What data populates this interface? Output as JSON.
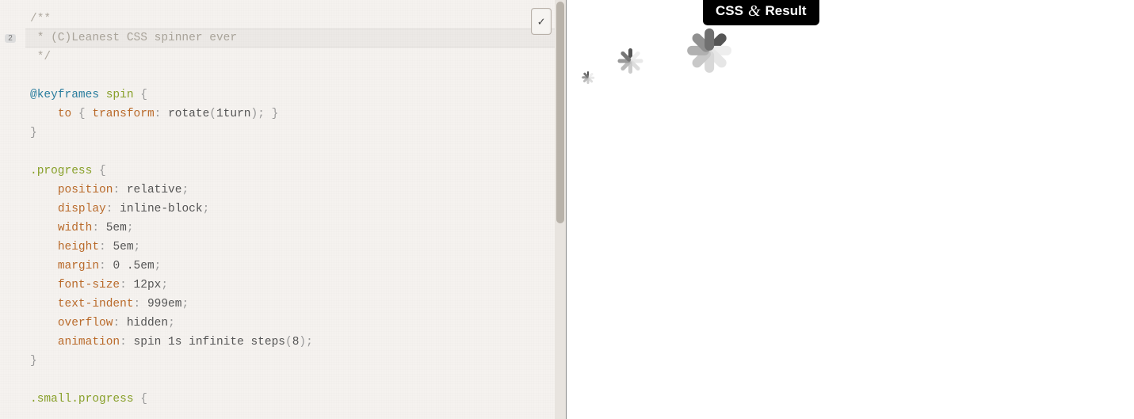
{
  "tab": {
    "left": "CSS",
    "amp": "&",
    "right": "Result"
  },
  "toggle_label": "✓",
  "lint": {
    "count": "2"
  },
  "code": {
    "l1": "/**",
    "l2a": " * ",
    "l2b": "(C)Leanest CSS spinner ever",
    "l3": " */",
    "l5a": "@keyframes",
    "l5b": "spin",
    "l5c": "{",
    "l6a": "to",
    "l6b": "{",
    "l6c": "transform",
    "l6d": ":",
    "l6e": "rotate",
    "l6f": "(",
    "l6g": "1turn",
    "l6h": ")",
    "l6i": ";",
    "l6j": "}",
    "l7": "}",
    "l9a": ".progress",
    "l9b": "{",
    "p_position": "position",
    "v_position": "relative",
    "p_display": "display",
    "v_display": "inline-block",
    "p_width": "width",
    "v_width": "5em",
    "p_height": "height",
    "v_height": "5em",
    "p_margin": "margin",
    "v_margin": "0 .5em",
    "p_fontsize": "font-size",
    "v_fontsize": "12px",
    "p_textindent": "text-indent",
    "v_textindent": "999em",
    "p_overflow": "overflow",
    "v_overflow": "hidden",
    "p_animation": "animation",
    "v_animation_a": "spin 1s infinite steps",
    "v_anim_paren_o": "(",
    "v_anim_num": "8",
    "v_anim_paren_c": ")",
    "close": "}",
    "small_sel": ".small.progress",
    "small_open": "{"
  }
}
